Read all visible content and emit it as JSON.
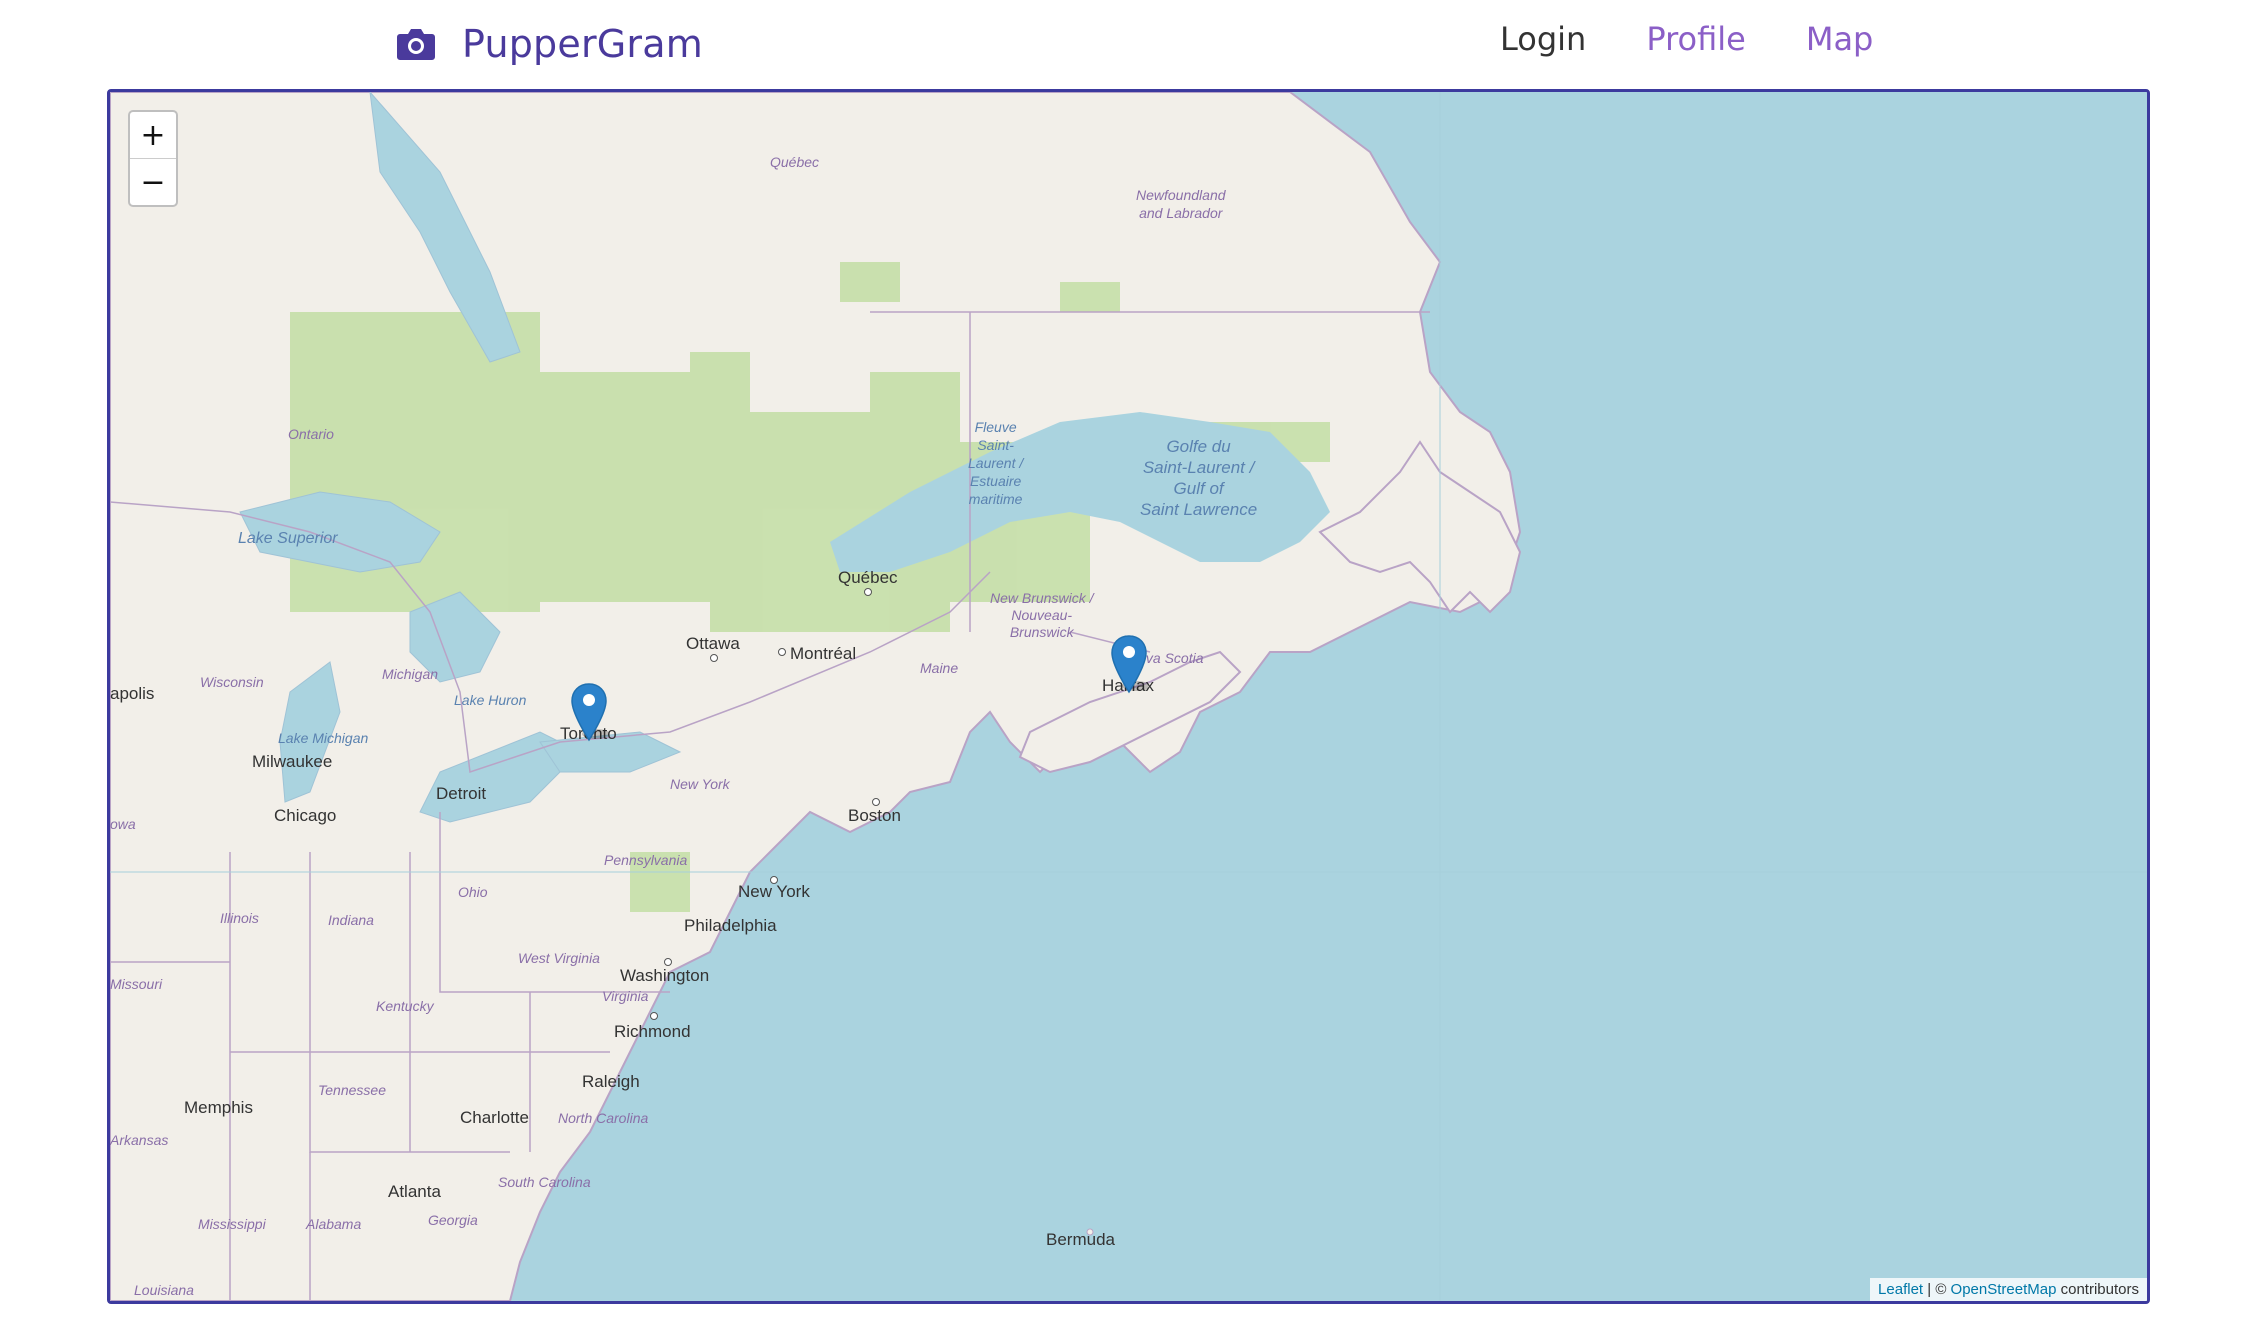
{
  "header": {
    "brand": "PupperGram",
    "brand_icon": "camera-icon",
    "nav": {
      "login": "Login",
      "profile": "Profile",
      "map": "Map"
    }
  },
  "map": {
    "zoom_in": "+",
    "zoom_out": "−",
    "attribution": {
      "leaflet": "Leaflet",
      "sep": " | © ",
      "osm": "OpenStreetMap",
      "contributors": " contributors"
    },
    "markers": [
      {
        "name": "Toronto",
        "icon": "map-pin-icon"
      },
      {
        "name": "Halifax",
        "icon": "map-pin-icon"
      }
    ],
    "cities": [
      "Toronto",
      "Halifax",
      "Québec",
      "Ottawa",
      "Montréal",
      "Boston",
      "New York",
      "Philadelphia",
      "Washington",
      "Richmond",
      "Raleigh",
      "Charlotte",
      "Atlanta",
      "Memphis",
      "Chicago",
      "Milwaukee",
      "Detroit",
      "apolis",
      "Bermuda"
    ],
    "regions": [
      "Québec",
      "Newfoundland",
      "and Labrador",
      "Ontario",
      "Wisconsin",
      "Michigan",
      "Maine",
      "New Brunswick /",
      "Nouveau-",
      "Brunswick",
      "Nova Scotia",
      "New York",
      "Pennsylvania",
      "Ohio",
      "Illinois",
      "Indiana",
      "West Virginia",
      "Virginia",
      "Kentucky",
      "Tennessee",
      "North Carolina",
      "South Carolina",
      "Georgia",
      "Alabama",
      "Mississippi",
      "Missouri",
      "Arkansas",
      "Louisiana",
      "owa"
    ],
    "water": [
      "Lake Superior",
      "Lake Huron",
      "Lake Michigan",
      "Fleuve",
      "Saint-",
      "Laurent /",
      "Estuaire",
      "maritime",
      "Golfe du",
      "Saint-Laurent /",
      "Gulf of",
      "Saint Lawrence"
    ],
    "colors": {
      "ocean": "#aad3df",
      "land": "#f2efe9",
      "forest": "#c5dfa8",
      "border": "#3c3a9e",
      "marker": "#2b82cb",
      "brand": "#4a3a9c",
      "nav_active": "#8b5fc7"
    }
  }
}
